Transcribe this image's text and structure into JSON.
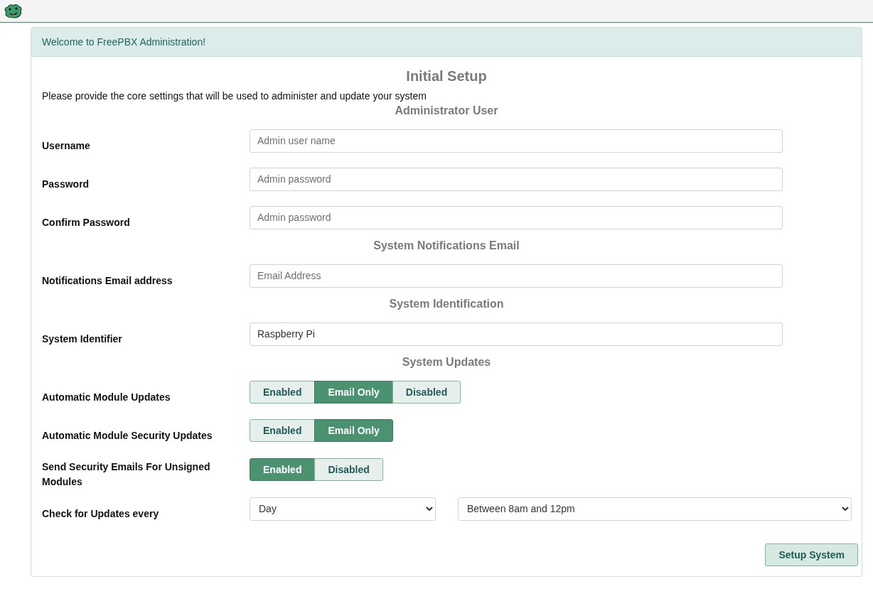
{
  "panel": {
    "header": "Welcome to FreePBX Administration!",
    "title": "Initial Setup",
    "intro": "Please provide the core settings that will be used to administer and update your system"
  },
  "sections": [
    {
      "heading": "Administrator User",
      "rows": [
        {
          "kind": "text",
          "label": "Username",
          "placeholder": "Admin user name"
        },
        {
          "kind": "text",
          "label": "Password",
          "placeholder": "Admin password"
        },
        {
          "kind": "text",
          "label": "Confirm Password",
          "placeholder": "Admin password"
        }
      ]
    },
    {
      "heading": "System Notifications Email",
      "rows": [
        {
          "kind": "text",
          "label": "Notifications Email address",
          "placeholder": "Email Address"
        }
      ]
    },
    {
      "heading": "System Identification",
      "rows": [
        {
          "kind": "text",
          "label": "System Identifier",
          "value": "Raspberry Pi"
        }
      ]
    },
    {
      "heading": "System Updates",
      "rows": [
        {
          "kind": "toggle",
          "label": "Automatic Module Updates",
          "options": [
            {
              "label": "Enabled",
              "selected": false
            },
            {
              "label": "Email Only",
              "selected": true
            },
            {
              "label": "Disabled",
              "selected": false
            }
          ]
        },
        {
          "kind": "toggle",
          "label": "Automatic Module Security Updates",
          "options": [
            {
              "label": "Enabled",
              "selected": false
            },
            {
              "label": "Email Only",
              "selected": true
            }
          ]
        },
        {
          "kind": "toggle",
          "label": "Send Security Emails For Unsigned Modules",
          "options": [
            {
              "label": "Enabled",
              "selected": true
            },
            {
              "label": "Disabled",
              "selected": false
            }
          ]
        },
        {
          "kind": "selects",
          "label": "Check for Updates every",
          "selects": [
            "Day",
            "Between 8am and 12pm"
          ]
        }
      ]
    }
  ],
  "submit": "Setup System"
}
